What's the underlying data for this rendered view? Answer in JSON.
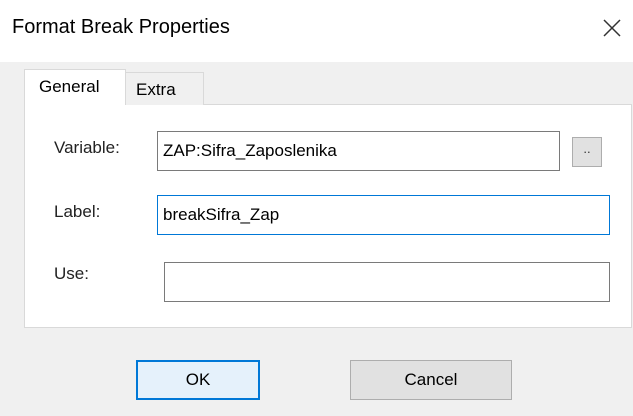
{
  "window": {
    "title": "Format Break Properties",
    "close_icon": "close-icon"
  },
  "tabs": [
    {
      "label": "General",
      "selected": true
    },
    {
      "label": "Extra",
      "selected": false
    }
  ],
  "form": {
    "variable": {
      "label": "Variable:",
      "value": "ZAP:Sifra_Zaposlenika"
    },
    "browse_button": {
      "label": ".."
    },
    "label_field": {
      "label": "Label:",
      "value": "breakSifra_Zap"
    },
    "use_field": {
      "label": "Use:",
      "value": ""
    }
  },
  "buttons": {
    "ok": "OK",
    "cancel": "Cancel"
  },
  "colors": {
    "accent": "#0078d7",
    "dialog_bg": "#f0f0f0",
    "panel_bg": "#ffffff"
  }
}
